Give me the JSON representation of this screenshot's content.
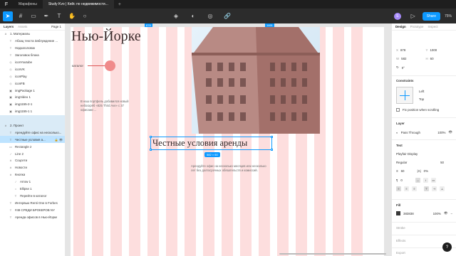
{
  "titlebar": {
    "logo": "F",
    "tabs": [
      {
        "label": "Марафоны"
      },
      {
        "label": "Study Kvo | Кейс по недвижимости..."
      }
    ],
    "plus": "+"
  },
  "toolbar": {
    "zoom": "75%",
    "share_label": "Share",
    "avatar": "S"
  },
  "layers_panel": {
    "tab_layers": "Layers",
    "tab_assets": "Assets",
    "page": "Page 1",
    "items": [
      {
        "label": "1. Материалы",
        "indent": 0,
        "icon": "#",
        "selected": false
      },
      {
        "label": "Абзац текста Заблуждение ...",
        "indent": 1,
        "icon": "T",
        "selected": false
      },
      {
        "label": "Надзаголовок",
        "indent": 1,
        "icon": "T",
        "selected": false
      },
      {
        "label": "Заголовок блока",
        "indent": 1,
        "icon": "T",
        "selected": false
      },
      {
        "label": "iconYoutube",
        "indent": 1,
        "icon": "◇",
        "selected": false
      },
      {
        "label": "iconVK",
        "indent": 1,
        "icon": "◇",
        "selected": false
      },
      {
        "label": "iconPlay",
        "indent": 1,
        "icon": "◇",
        "selected": false
      },
      {
        "label": "iconFB",
        "indent": 1,
        "icon": "◇",
        "selected": false
      },
      {
        "label": "imgPackage 1",
        "indent": 1,
        "icon": "▣",
        "selected": false
      },
      {
        "label": "imgVideo 1",
        "indent": 1,
        "icon": "▣",
        "selected": false
      },
      {
        "label": "img1155-2-1",
        "indent": 1,
        "icon": "▣",
        "selected": false
      },
      {
        "label": "img1155-1 1",
        "indent": 1,
        "icon": "▣",
        "selected": false
      },
      {
        "label": "",
        "indent": 0,
        "icon": "",
        "selected": true
      },
      {
        "label": "2. Проект",
        "indent": 0,
        "icon": "#",
        "selected": true
      },
      {
        "label": "Арендуйте офис на несколько...",
        "indent": 1,
        "icon": "T",
        "selected": true
      },
      {
        "label": "Честные условия а...",
        "indent": 1,
        "icon": "T",
        "selected": "strong"
      },
      {
        "label": "Rectangle 2",
        "indent": 1,
        "icon": "▭",
        "selected": false
      },
      {
        "label": "Line 2",
        "indent": 1,
        "icon": "/",
        "selected": false
      },
      {
        "label": "Соцсети",
        "indent": 1,
        "icon": "#",
        "selected": false
      },
      {
        "label": "Новости",
        "indent": 1,
        "icon": "#",
        "selected": false
      },
      {
        "label": "Кнопка",
        "indent": 1,
        "icon": "#",
        "selected": false
      },
      {
        "label": "Arrow 1",
        "indent": 2,
        "icon": "/",
        "selected": false
      },
      {
        "label": "Ellipse 1",
        "indent": 2,
        "icon": "○",
        "selected": false
      },
      {
        "label": "Перейти в каталог",
        "indent": 2,
        "icon": "T",
        "selected": false
      },
      {
        "label": "Интервью Renti One в Forbes",
        "indent": 1,
        "icon": "T",
        "selected": false
      },
      {
        "label": "#49 СРЕДИ БРОКЕРОВ NY",
        "indent": 1,
        "icon": "T",
        "selected": false
      },
      {
        "label": "Аренда офисов в Нью-Йорке",
        "indent": 1,
        "icon": "T",
        "selected": false
      }
    ]
  },
  "canvas": {
    "heading": "Нью-Йорке",
    "catalog_label": "каталог",
    "paragraph1": "В наш портфель добавился новый небоскрёб «825 Third Ave» с 37 офисами ...",
    "heading2": "Честные условия аренды",
    "size_badge": "582 × 60",
    "paragraph2": "Арендуйте офис на несколько месяцев или несколько лет без долгосрочных обязательств и комиссий.",
    "ruler_left": "878",
    "ruler_right": "1461"
  },
  "properties": {
    "tab_design": "Design",
    "tab_prototype": "Prototype",
    "tab_inspect": "Inspect",
    "x_label": "X",
    "x": "878",
    "y_label": "Y",
    "y": "1000",
    "w_label": "W",
    "w": "582",
    "h_label": "H",
    "h": "60",
    "rotation": "0°",
    "constraints_title": "Constraints",
    "constraint_h": "Left",
    "constraint_v": "Top",
    "fix_position": "Fix position when scrolling",
    "layer_title": "Layer",
    "blend": "Pass Through",
    "layer_opacity": "100%",
    "text_title": "Text",
    "font_family": "Playfair Display",
    "font_weight": "Regular",
    "font_size": "50",
    "line_height": "60",
    "letter_spacing": "0%",
    "paragraph_spacing": "0",
    "fill_title": "Fill",
    "fill_hex": "383838",
    "fill_opacity": "100%",
    "stroke_title": "Stroke",
    "effects_title": "Effects",
    "export_title": "Export",
    "accent": "#0d99ff"
  }
}
